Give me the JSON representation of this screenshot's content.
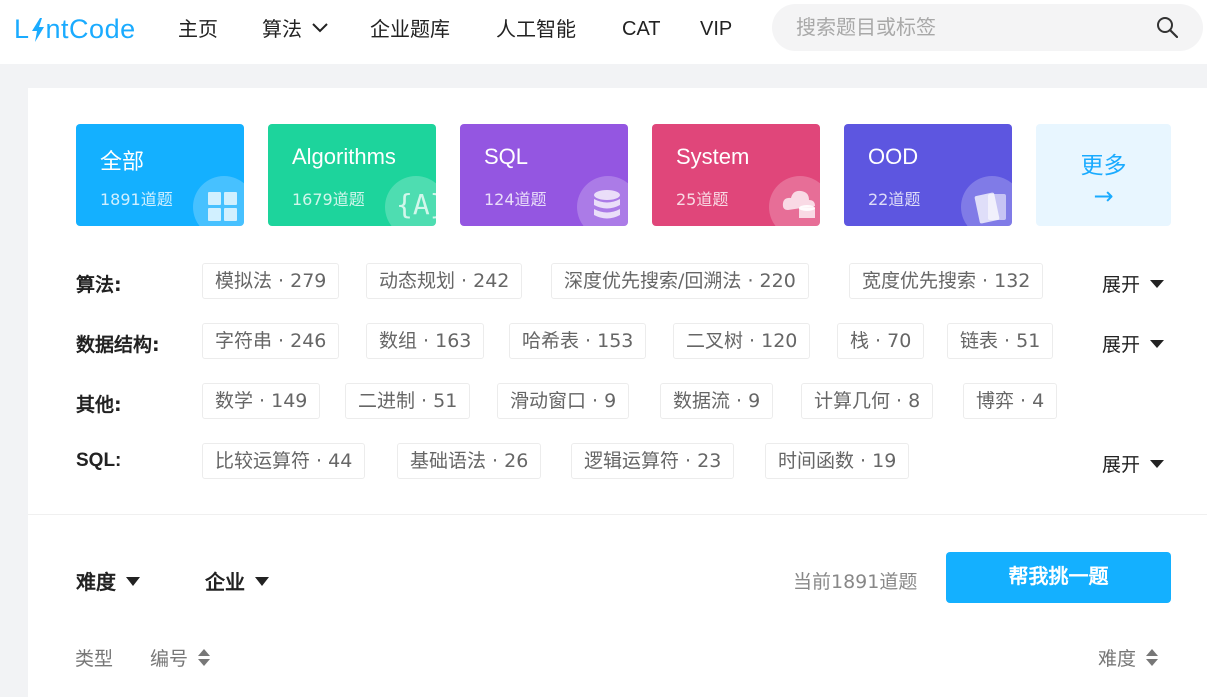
{
  "header": {
    "logo_text": "LintCode",
    "logo_prefix": "L",
    "logo_suffix": "ntCode",
    "nav": [
      {
        "label": "主页"
      },
      {
        "label": "算法"
      },
      {
        "label": "企业题库"
      },
      {
        "label": "人工智能"
      },
      {
        "label": "CAT"
      },
      {
        "label": "VIP"
      }
    ],
    "search_placeholder": "搜索题目或标签",
    "brand_color": "#1aabff"
  },
  "categories": [
    {
      "title": "全部",
      "count": "1891道题",
      "color": "#14b0ff",
      "icon": "grid-icon"
    },
    {
      "title": "Algorithms",
      "count": "1679道题",
      "color": "#1dd49c",
      "icon": "braces-a-icon"
    },
    {
      "title": "SQL",
      "count": "124道题",
      "color": "#9456e1",
      "icon": "database-icon"
    },
    {
      "title": "System",
      "count": "25道题",
      "color": "#e0467a",
      "icon": "cloud-database-icon"
    },
    {
      "title": "OOD",
      "count": "22道题",
      "color": "#5d56e0",
      "icon": "cards-icon"
    }
  ],
  "more_card": {
    "label": "更多",
    "arrow": "→"
  },
  "tag_rows": [
    {
      "label": "算法:",
      "tags": [
        "模拟法 · 279",
        "动态规划 · 242",
        "深度优先搜索/回溯法 · 220",
        "宽度优先搜索 · 132"
      ],
      "expand": "展开"
    },
    {
      "label": "数据结构:",
      "tags": [
        "字符串 · 246",
        "数组 · 163",
        "哈希表 · 153",
        "二叉树 · 120",
        "栈 · 70",
        "链表 · 51"
      ],
      "expand": "展开"
    },
    {
      "label": "其他:",
      "tags": [
        "数学 · 149",
        "二进制 · 51",
        "滑动窗口 · 9",
        "数据流 · 9",
        "计算几何 · 8",
        "博弈 · 4"
      ]
    },
    {
      "label": "SQL:",
      "tags": [
        "比较运算符 · 44",
        "基础语法 · 26",
        "逻辑运算符 · 23",
        "时间函数 · 19"
      ],
      "expand": "展开"
    }
  ],
  "filters": {
    "difficulty": "难度",
    "company": "企业"
  },
  "current_count": "当前1891道题",
  "pick_button": "帮我挑一题",
  "table_header": {
    "type": "类型",
    "number": "编号",
    "difficulty": "难度"
  }
}
